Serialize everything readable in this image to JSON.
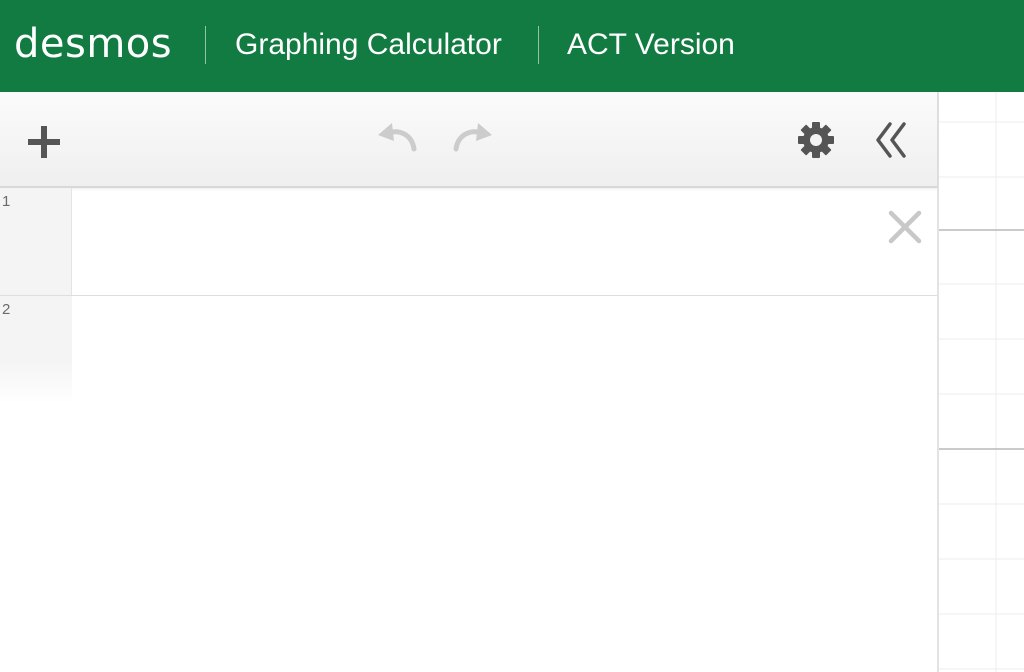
{
  "header": {
    "logo": "desmos",
    "app_title": "Graphing Calculator",
    "version": "ACT Version",
    "background": "#127b42"
  },
  "toolbar": {
    "add_icon": "plus-icon",
    "undo_icon": "undo-icon",
    "redo_icon": "redo-icon",
    "settings_icon": "gear-icon",
    "collapse_icon": "double-chevron-left-icon"
  },
  "expressions": [
    {
      "number": "1",
      "value": ""
    },
    {
      "number": "2",
      "value": ""
    }
  ],
  "colors": {
    "icon_dark": "#555555",
    "icon_disabled": "#cccccc",
    "delete_icon": "#c8c8c8",
    "grid_minor": "#ececec",
    "grid_major": "#b9b9b9"
  }
}
